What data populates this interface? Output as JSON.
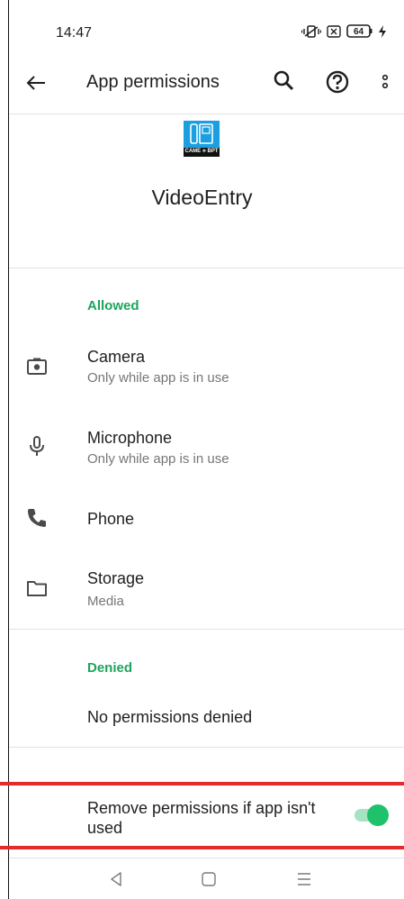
{
  "status_bar": {
    "time": "14:47",
    "battery_level": "64",
    "icons": [
      "vibrate-icon",
      "nfc-icon",
      "battery-icon",
      "charging-icon"
    ]
  },
  "app_bar": {
    "title": "App permissions",
    "icons": [
      "back-arrow-icon",
      "search-icon",
      "help-icon",
      "more-vert-icon"
    ]
  },
  "app": {
    "name": "VideoEntry",
    "logo_text": "CAME ⟡ BPT",
    "logo_color": "#1aa0e0"
  },
  "sections": {
    "allowed_label": "Allowed",
    "denied_label": "Denied",
    "denied_empty": "No permissions denied",
    "accent_color": "#1ea35d"
  },
  "permissions": [
    {
      "title": "Camera",
      "subtitle": "Only while app is in use",
      "icon": "camera-icon"
    },
    {
      "title": "Microphone",
      "subtitle": "Only while app is in use",
      "icon": "microphone-icon"
    },
    {
      "title": "Phone",
      "subtitle": "",
      "icon": "phone-icon"
    },
    {
      "title": "Storage",
      "subtitle": "Media",
      "icon": "folder-icon"
    }
  ],
  "remove_unused": {
    "label": "Remove permissions if app isn't used",
    "enabled": true,
    "highlight_color": "#e42b2b"
  },
  "nav_bar": {
    "icons": [
      "back-triangle-icon",
      "home-square-icon",
      "recents-menu-icon"
    ]
  }
}
